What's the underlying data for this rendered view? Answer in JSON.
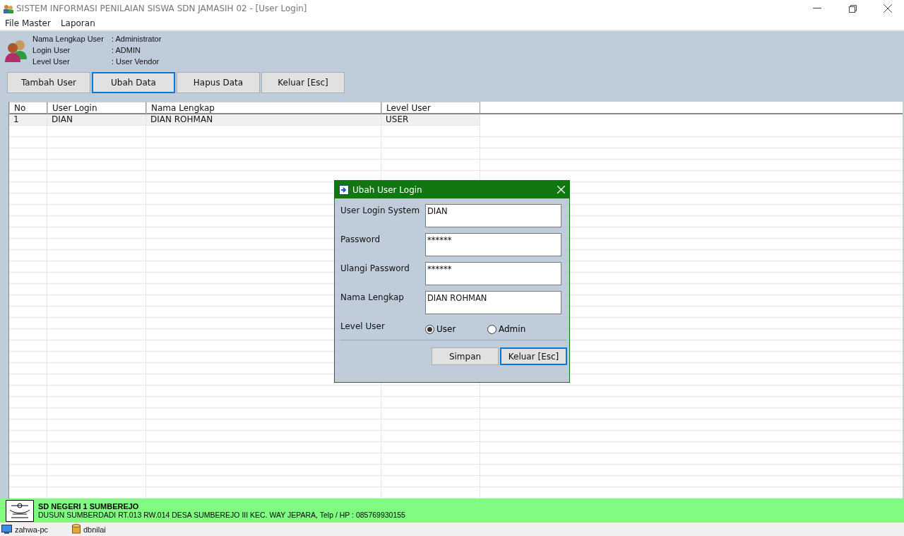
{
  "window": {
    "title": "SISTEM INFORMASI PENILAIAN SISWA SDN JAMASIH 02 - [User Login]"
  },
  "menu": [
    "File Master",
    "Laporan"
  ],
  "user_info": [
    {
      "label": "Nama Lengkap User",
      "value": ": Administrator"
    },
    {
      "label": "Login User",
      "value": ": ADMIN"
    },
    {
      "label": "Level User",
      "value": ": User Vendor"
    }
  ],
  "toolbar": [
    {
      "label": "Tambah User",
      "selected": false
    },
    {
      "label": "Ubah Data",
      "selected": true
    },
    {
      "label": "Hapus Data",
      "selected": false
    },
    {
      "label": "Keluar [Esc]",
      "selected": false
    }
  ],
  "table": {
    "columns": [
      "No",
      "User Login",
      "Nama Lengkap",
      "Level User"
    ],
    "rows": [
      [
        "1",
        "DIAN",
        "DIAN ROHMAN",
        "USER"
      ]
    ]
  },
  "dialog": {
    "title": "Ubah User Login",
    "fields": [
      {
        "label": "User Login System",
        "value": "DIAN"
      },
      {
        "label": "Password",
        "value": "******"
      },
      {
        "label": "Ulangi Password",
        "value": "******"
      },
      {
        "label": "Nama Lengkap",
        "value": "DIAN ROHMAN"
      }
    ],
    "level": {
      "label": "Level User",
      "options": [
        {
          "label": "User",
          "selected": true
        },
        {
          "label": "Admin",
          "selected": false
        }
      ]
    },
    "buttons": [
      {
        "label": "Simpan",
        "selected": false
      },
      {
        "label": "Keluar [Esc]",
        "selected": true
      }
    ]
  },
  "footer": {
    "name": "SD NEGERI 1 SUMBEREJO",
    "address": "DUSUN SUMBERDADI RT.013 RW.014 DESA SUMBEREJO III KEC. WAY JEPARA, Telp / HP : 085769930155"
  },
  "status_bar": [
    "zahwa-pc",
    "dbnilai"
  ]
}
